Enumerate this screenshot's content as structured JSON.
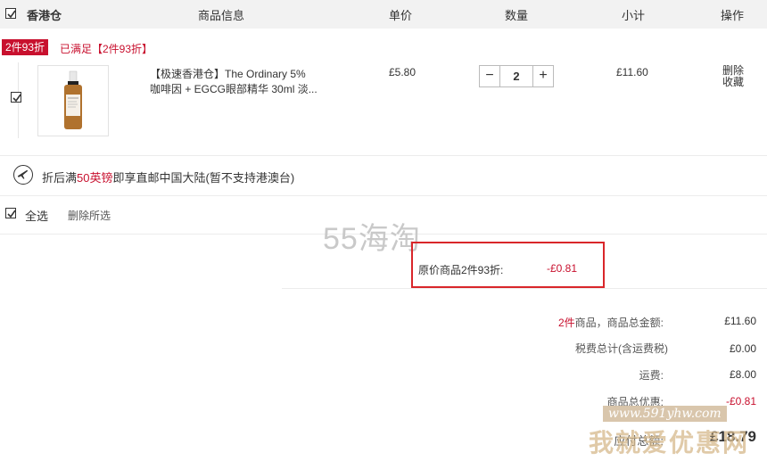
{
  "header": {
    "warehouse_label": "香港仓",
    "col_info": "商品信息",
    "col_price": "单价",
    "col_qty": "数量",
    "col_subtotal": "小计",
    "col_actions": "操作"
  },
  "promo": {
    "badge": "2件93折",
    "status": "已满足【2件93折】"
  },
  "item": {
    "title": "【极速香港仓】The Ordinary 5% 咖啡因 + EGCG眼部精华 30ml 淡...",
    "price": "£5.80",
    "quantity": "2",
    "minus": "−",
    "plus": "+",
    "subtotal": "£11.60",
    "action_delete": "删除",
    "action_favorite": "收藏",
    "thumb_brand": "The Ordinary"
  },
  "shipping": {
    "text_before": "折后满",
    "amount": "50英镑",
    "text_after": "即享直邮中国大陆(暂不支持港澳台)"
  },
  "select_all": {
    "label": "全选",
    "delete_selected": "删除所选"
  },
  "discount": {
    "label": "原价商品2件93折:",
    "value": "-£0.81"
  },
  "summary": {
    "count_label_prefix": "2件",
    "count_label_suffix": "商品，商品总金额:",
    "total_goods": "£11.60",
    "tax_label": "税费总计(含运费税)",
    "tax": "£0.00",
    "shipping_label": "运费:",
    "shipping": "£8.00",
    "discount_label": "商品总优惠:",
    "discount": "-£0.81",
    "payable_label": "应付总额:",
    "payable": "£18.79"
  },
  "watermarks": {
    "site": "55海淘",
    "url": "www.591yhw.com",
    "slogan": "我就爱优惠网"
  },
  "colors": {
    "accent_red": "#c8102e",
    "highlight_box": "#d9262a",
    "header_bg": "#f2f2f2"
  }
}
